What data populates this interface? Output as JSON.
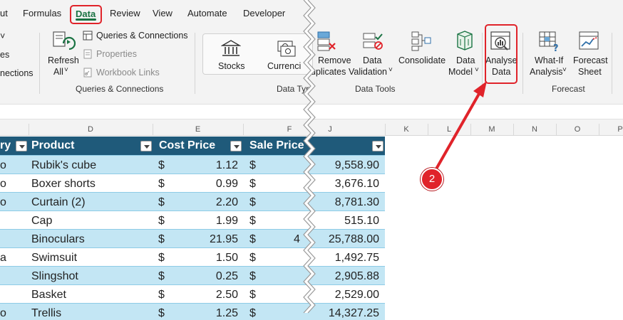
{
  "tabs": [
    {
      "label": "ut"
    },
    {
      "label": "Formulas"
    },
    {
      "label": "Data",
      "active": true
    },
    {
      "label": "Review"
    },
    {
      "label": "View"
    },
    {
      "label": "Automate"
    },
    {
      "label": "Developer"
    }
  ],
  "ribbon": {
    "left_partial": [
      "es",
      "nections"
    ],
    "queries": {
      "refresh_label": "Refresh",
      "refresh_all_label": "All",
      "queries_connections": "Queries & Connections",
      "properties": "Properties",
      "workbook_links": "Workbook Links",
      "group_label": "Queries & Connections"
    },
    "data_types": {
      "stocks": "Stocks",
      "currencies": "Currenci",
      "group_label": "Data Typ"
    },
    "data_tools": {
      "remove_duplicates_1": "Remove",
      "remove_duplicates_2": "uplicates",
      "data_validation_1": "Data",
      "data_validation_2": "Validation",
      "consolidate": "Consolidate",
      "data_model_1": "Data",
      "data_model_2": "Model",
      "group_label": "Data Tools"
    },
    "analyse": {
      "line1": "Analyse",
      "line2": "Data"
    },
    "forecast": {
      "whatif_1": "What-If",
      "whatif_2": "Analysis",
      "sheet_1": "Forecast",
      "sheet_2": "Sheet",
      "group_label": "Forecast"
    }
  },
  "columns": [
    "D",
    "E",
    "F",
    "J",
    "K",
    "L",
    "M",
    "N",
    "O",
    "P"
  ],
  "table": {
    "headers": [
      "ry",
      "Product",
      "Cost Price",
      "Sale Price",
      ""
    ],
    "rows": [
      {
        "c0": "o",
        "product": "Rubik's cube",
        "cur": "$",
        "cost": "1.12",
        "cur2": "$",
        "sale": "",
        "total": "9,558.90"
      },
      {
        "c0": "o",
        "product": "Boxer shorts",
        "cur": "$",
        "cost": "0.99",
        "cur2": "$",
        "sale": "",
        "total": "3,676.10"
      },
      {
        "c0": "o",
        "product": "Curtain (2)",
        "cur": "$",
        "cost": "2.20",
        "cur2": "$",
        "sale": "",
        "total": "8,781.30"
      },
      {
        "c0": "",
        "product": "Cap",
        "cur": "$",
        "cost": "1.99",
        "cur2": "$",
        "sale": "",
        "total": "515.10"
      },
      {
        "c0": "",
        "product": "Binoculars",
        "cur": "$",
        "cost": "21.95",
        "cur2": "$",
        "sale": "4",
        "total": "25,788.00"
      },
      {
        "c0": "a",
        "product": "Swimsuit",
        "cur": "$",
        "cost": "1.50",
        "cur2": "$",
        "sale": "",
        "total": "1,492.75"
      },
      {
        "c0": "",
        "product": "Slingshot",
        "cur": "$",
        "cost": "0.25",
        "cur2": "$",
        "sale": "",
        "total": "2,905.88"
      },
      {
        "c0": "",
        "product": "Basket",
        "cur": "$",
        "cost": "2.50",
        "cur2": "$",
        "sale": "",
        "total": "2,529.00"
      },
      {
        "c0": "o",
        "product": "Trellis",
        "cur": "$",
        "cost": "1.25",
        "cur2": "$",
        "sale": "",
        "total": "14,327.25"
      }
    ]
  },
  "callout": {
    "number": "2"
  },
  "colors": {
    "accent_red": "#e0232a",
    "excel_green": "#1a7343",
    "table_header": "#1f5a7a",
    "band": "#c3e6f4"
  }
}
